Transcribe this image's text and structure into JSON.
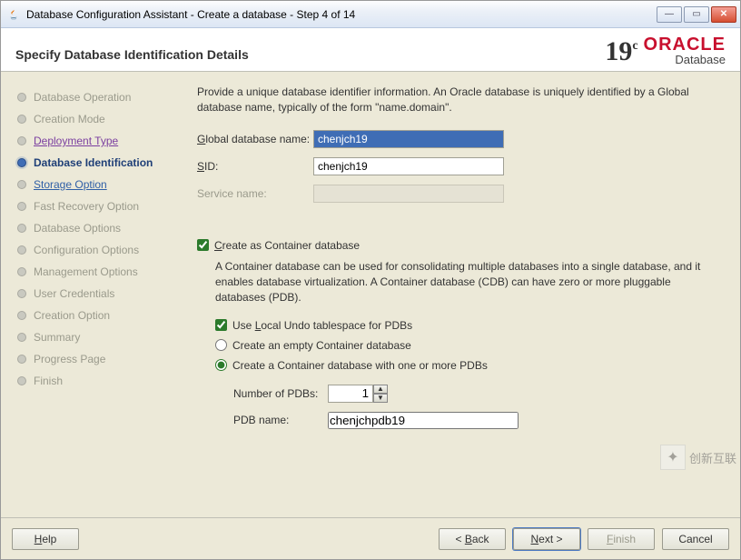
{
  "window": {
    "title": "Database Configuration Assistant - Create a database - Step 4 of 14"
  },
  "header": {
    "title": "Specify Database Identification Details",
    "brand_version_main": "19",
    "brand_version_sup": "c",
    "brand_name": "ORACLE",
    "brand_sub": "Database"
  },
  "sidebar": {
    "items": [
      {
        "label": "Database Operation"
      },
      {
        "label": "Creation Mode"
      },
      {
        "label": "Deployment Type"
      },
      {
        "label": "Database Identification"
      },
      {
        "label": "Storage Option"
      },
      {
        "label": "Fast Recovery Option"
      },
      {
        "label": "Database Options"
      },
      {
        "label": "Configuration Options"
      },
      {
        "label": "Management Options"
      },
      {
        "label": "User Credentials"
      },
      {
        "label": "Creation Option"
      },
      {
        "label": "Summary"
      },
      {
        "label": "Progress Page"
      },
      {
        "label": "Finish"
      }
    ]
  },
  "content": {
    "instruction": "Provide a unique database identifier information. An Oracle database is uniquely identified by a Global database name, typically of the form \"name.domain\".",
    "global_db_label_pre": "G",
    "global_db_label_post": "lobal database name:",
    "global_db_value": "chenjch19",
    "sid_label_pre": "S",
    "sid_label_post": "ID:",
    "sid_value": "chenjch19",
    "service_label": "Service name:",
    "service_value": "",
    "create_container_pre": "C",
    "create_container_post": "reate as Container database",
    "container_desc": "A Container database can be used for consolidating multiple databases into a single database, and it enables database virtualization. A Container database (CDB) can have zero or more pluggable databases (PDB).",
    "local_undo_pre": "Use ",
    "local_undo_ul": "L",
    "local_undo_post": "ocal Undo tablespace for PDBs",
    "empty_cdb": "Create an empty Container database",
    "cdb_with_pdb": "Create a Container database with one or more PDBs",
    "num_pdbs_pre": "Nu",
    "num_pdbs_ul": "m",
    "num_pdbs_post": "ber of PDBs:",
    "num_pdbs_value": "1",
    "pdb_name_ul": "P",
    "pdb_name_post": "DB name:",
    "pdb_name_value": "chenjchpdb19"
  },
  "footer": {
    "help_ul": "H",
    "help_post": "elp",
    "back_pre": "< ",
    "back_ul": "B",
    "back_post": "ack",
    "next_ul": "N",
    "next_post": "ext >",
    "finish_ul": "F",
    "finish_post": "inish",
    "cancel": "Cancel"
  },
  "watermark": {
    "text": "创新互联"
  }
}
